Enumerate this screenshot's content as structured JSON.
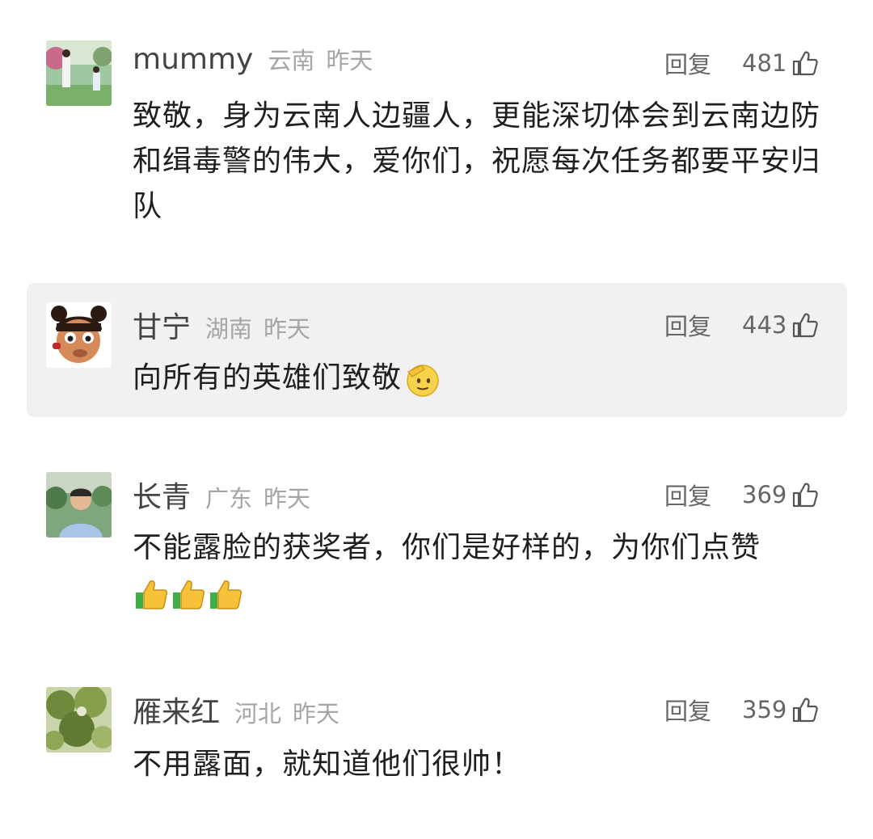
{
  "comments": [
    {
      "username": "mummy",
      "location": "云南",
      "time": "昨天",
      "reply": "回复",
      "likes": "481",
      "text": "致敬，身为云南人边疆人，更能深切体会到云南边防和缉毒警的伟大，爱你们，祝愿每次任务都要平安归队"
    },
    {
      "username": "甘宁",
      "location": "湖南",
      "time": "昨天",
      "reply": "回复",
      "likes": "443",
      "text": "向所有的英雄们致敬"
    },
    {
      "username": "长青",
      "location": "广东",
      "time": "昨天",
      "reply": "回复",
      "likes": "369",
      "text": "不能露脸的获奖者，你们是好样的，为你们点赞"
    },
    {
      "username": "雁来红",
      "location": "河北",
      "time": "昨天",
      "reply": "回复",
      "likes": "359",
      "text": "不用露面，就知道他们很帅！"
    }
  ],
  "icons": {
    "like": "thumbs-up-outline-icon",
    "salute": "saluting-face-emoji",
    "thumbs_up": "thumbs-up-emoji"
  }
}
